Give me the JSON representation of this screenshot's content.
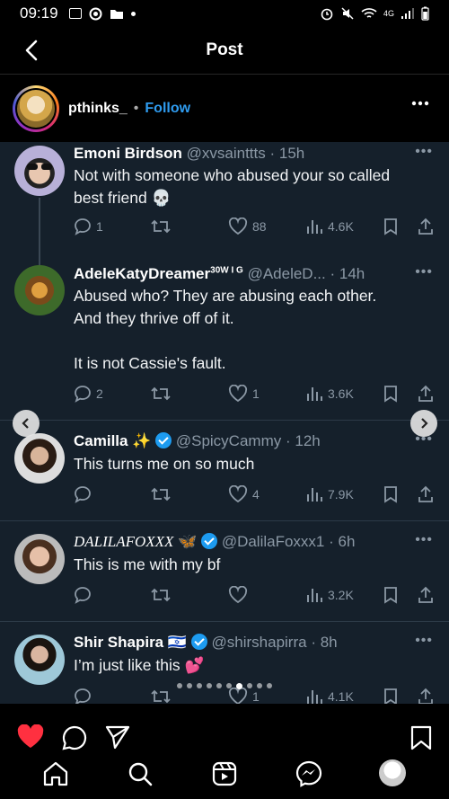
{
  "status_bar": {
    "time": "09:19",
    "network": "4G"
  },
  "nav": {
    "title": "Post"
  },
  "post": {
    "username": "pthinks_",
    "separator": "•",
    "follow_label": "Follow"
  },
  "tweets": [
    {
      "name": "Emoni Birdson",
      "handle": "@xvsainttts",
      "time": "· 15h",
      "text_lines": [
        "Not with someone who abused your so called",
        "best friend 💀"
      ],
      "replies": "1",
      "retweets": "",
      "likes": "88",
      "views": "4.6K"
    },
    {
      "name": "AdeleKatyDreamer",
      "badge": "30W I G",
      "handle": "@AdeleD...",
      "time": "· 14h",
      "text_lines": [
        "Abused who? They are abusing each other.",
        "And they thrive off of it.",
        "",
        "It is not Cassie's fault."
      ],
      "replies": "2",
      "retweets": "",
      "likes": "1",
      "views": "3.6K"
    },
    {
      "name": "Camilla",
      "emoji": "✨",
      "handle": "@SpicyCammy",
      "time": "· 12h",
      "text_lines": [
        "This turns me on so much"
      ],
      "replies": "",
      "retweets": "",
      "likes": "4",
      "views": "7.9K"
    },
    {
      "name": "DALILAFOXXX",
      "emoji": "🦋",
      "handle": "@DalilaFoxxx1",
      "time": "· 6h",
      "text_lines": [
        "This is me with my bf"
      ],
      "replies": "",
      "retweets": "",
      "likes": "",
      "views": "3.2K"
    },
    {
      "name": "Shir Shapira",
      "emoji": "🇮🇱",
      "handle": "@shirshapirra",
      "time": "· 8h",
      "text_lines": [
        "I’m just like this 💕"
      ],
      "replies": "",
      "retweets": "",
      "likes": "1",
      "views": "4.1K"
    }
  ],
  "carousel": {
    "total": 10,
    "active_index": 6,
    "prev_icon": "chevron-left-icon",
    "next_icon": "chevron-right-icon"
  },
  "colors": {
    "tweet_bg": "#15202b",
    "accent_blue": "#1d9bf0",
    "like_red": "#ff3040",
    "muted": "#8b98a5"
  },
  "post_actions": {
    "liked": true
  }
}
